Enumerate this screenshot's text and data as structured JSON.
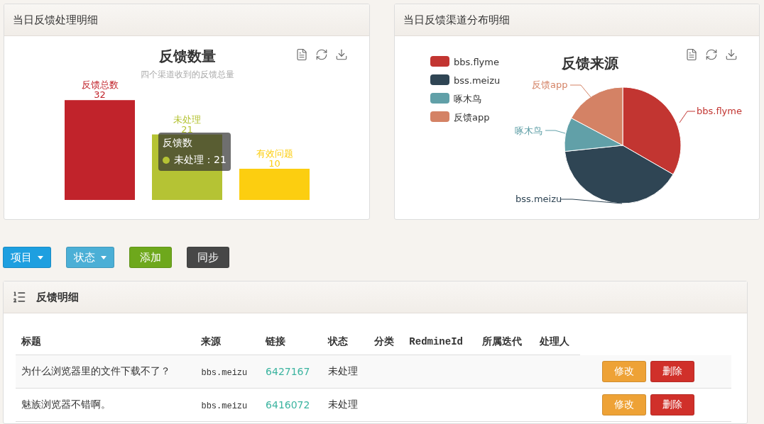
{
  "panels": [
    {
      "title": "当日反馈处理明细",
      "kind": "bar",
      "chart": {
        "subtitle": "四个渠道收到的反馈总量",
        "chart_data": {
          "type": "bar",
          "title": "反馈数量",
          "data_labels": true,
          "series": [
            {
              "name": "反馈总数",
              "color": "#c1232b",
              "values": [
                32
              ]
            },
            {
              "name": "未处理",
              "color": "#b5c334",
              "values": [
                21
              ]
            },
            {
              "name": "有效问题",
              "color": "#fcce10",
              "values": [
                10
              ]
            }
          ]
        },
        "tooltip": {
          "title": "反馈数",
          "text": "未处理：21",
          "color": "#b5c334"
        }
      }
    },
    {
      "title": "当日反馈渠道分布明细",
      "kind": "pie",
      "chart": {
        "title": "反馈来源",
        "legend": [
          {
            "label": "bbs.flyme",
            "color": "#c23531"
          },
          {
            "label": "bss.meizu",
            "color": "#2f4554"
          },
          {
            "label": "啄木鸟",
            "color": "#61a0a8"
          },
          {
            "label": "反馈app",
            "color": "#d48265"
          }
        ],
        "slice_labels": [
          {
            "label": "反馈app",
            "color": "#d48265"
          },
          {
            "label": "bbs.flyme",
            "color": "#c23531"
          },
          {
            "label": "啄木鸟",
            "color": "#61a0a8"
          },
          {
            "label": "bss.meizu",
            "color": "#2f4554"
          }
        ]
      }
    }
  ],
  "toolbar": [
    {
      "label": "项目",
      "kind": "primary",
      "dropdown": true
    },
    {
      "label": "状态",
      "kind": "info",
      "dropdown": true
    },
    {
      "label": "添加",
      "kind": "success",
      "dropdown": false
    },
    {
      "label": "同步",
      "kind": "dark",
      "dropdown": false
    }
  ],
  "table_panel": {
    "title": "反馈明细",
    "columns": [
      "标题",
      "来源",
      "链接",
      "状态",
      "分类",
      "RedmineId",
      "所属迭代",
      "处理人"
    ],
    "rows": [
      {
        "cells": [
          "为什么浏览器里的文件下载不了？",
          "bbs.meizu",
          "6427167",
          "未处理"
        ],
        "actions": [
          {
            "label": "修改",
            "kind": "warning"
          },
          {
            "label": "删除",
            "kind": "danger"
          }
        ]
      },
      {
        "cells": [
          "魅族浏览器不错啊。",
          "bbs.meizu",
          "6416072",
          "未处理"
        ],
        "actions": [
          {
            "label": "修改",
            "kind": "warning"
          },
          {
            "label": "删除",
            "kind": "danger"
          }
        ]
      }
    ]
  }
}
